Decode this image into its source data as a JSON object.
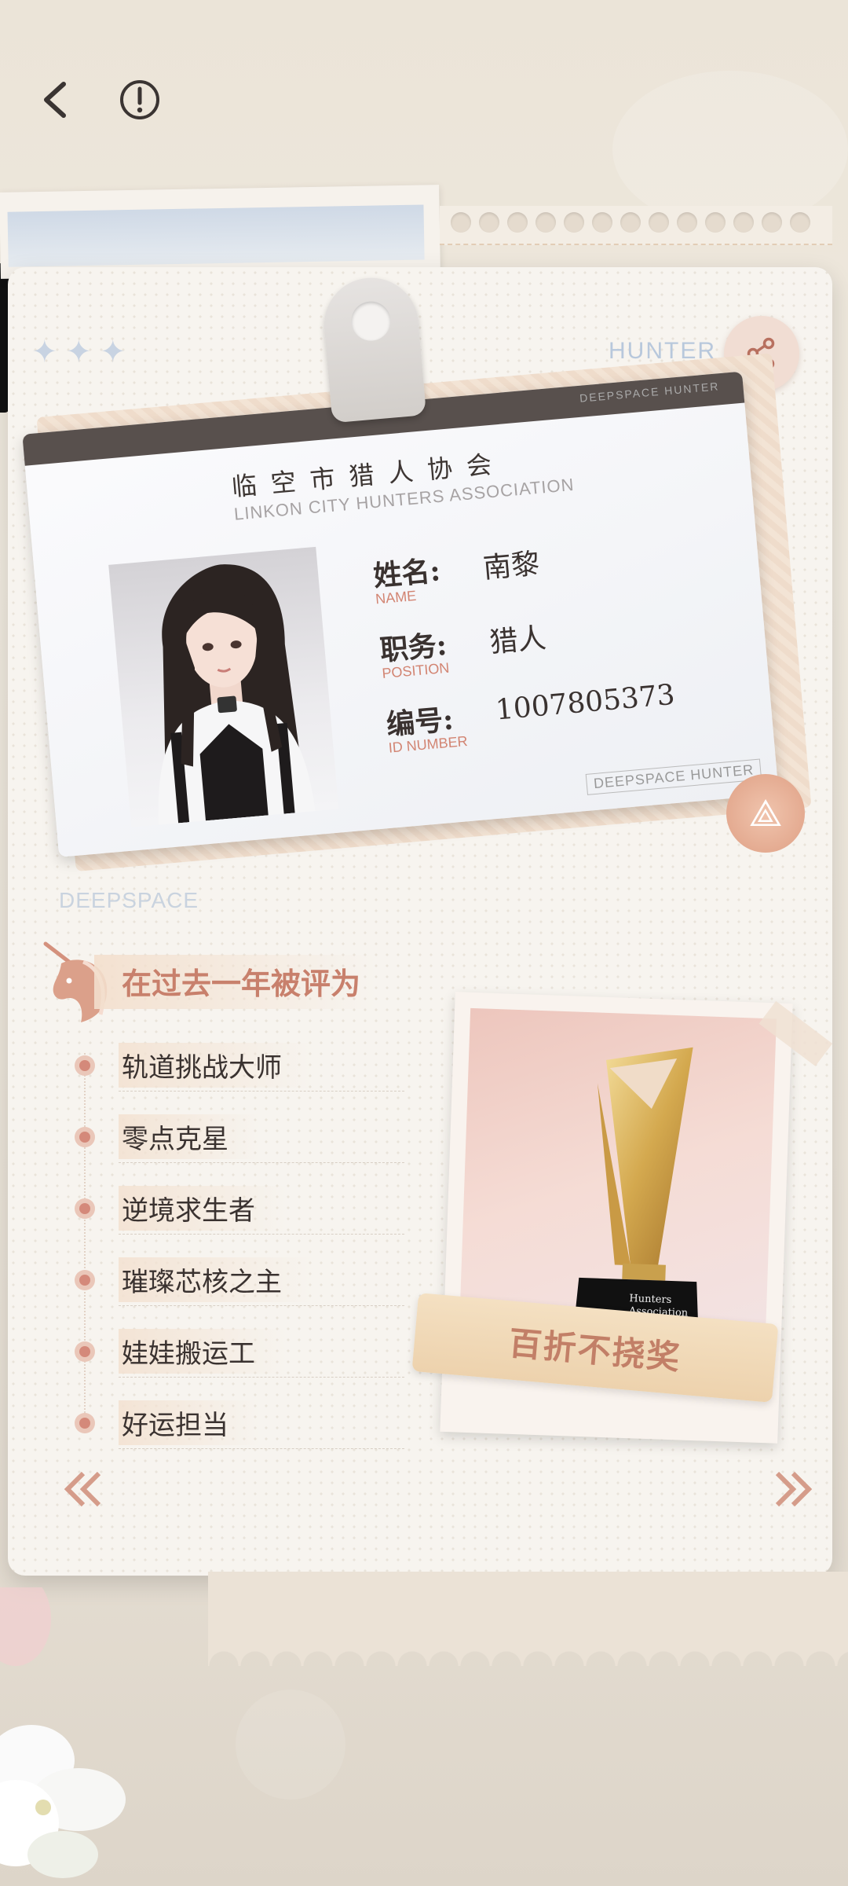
{
  "header": {
    "back_icon": "chevron-left-icon",
    "info_icon": "exclamation-circle-icon",
    "share_icon": "share-icon"
  },
  "card": {
    "hunter_label": "HUNTER",
    "deepspace_label": "DEEPSPACE",
    "id_card": {
      "top_bar_text": "DEEPSPACE HUNTER",
      "org_cn": "临空市猎人协会",
      "org_en": "LINKON CITY HUNTERS ASSOCIATION",
      "name_label": "姓名:",
      "name_label_en": "NAME",
      "name_value": "南黎",
      "position_label": "职务:",
      "position_label_en": "POSITION",
      "position_value": "猎人",
      "id_label": "编号:",
      "id_label_en": "ID NUMBER",
      "id_value": "1007805373",
      "bottom_tag": "DEEPSPACE HUNTER"
    }
  },
  "awards": {
    "section_title": "在过去一年被评为",
    "items": [
      "轨道挑战大师",
      "零点克星",
      "逆境求生者",
      "璀璨芯核之主",
      "娃娃搬运工",
      "好运担当"
    ],
    "trophy_base_text_1": "Hunters",
    "trophy_base_text_2": "Association",
    "featured_award": "百折不挠奖"
  },
  "nav": {
    "prev_icon": "double-chevron-left-icon",
    "next_icon": "double-chevron-right-icon"
  },
  "colors": {
    "accent": "#c8806c",
    "dark_bar": "#58504d",
    "label_en": "#d28472"
  }
}
